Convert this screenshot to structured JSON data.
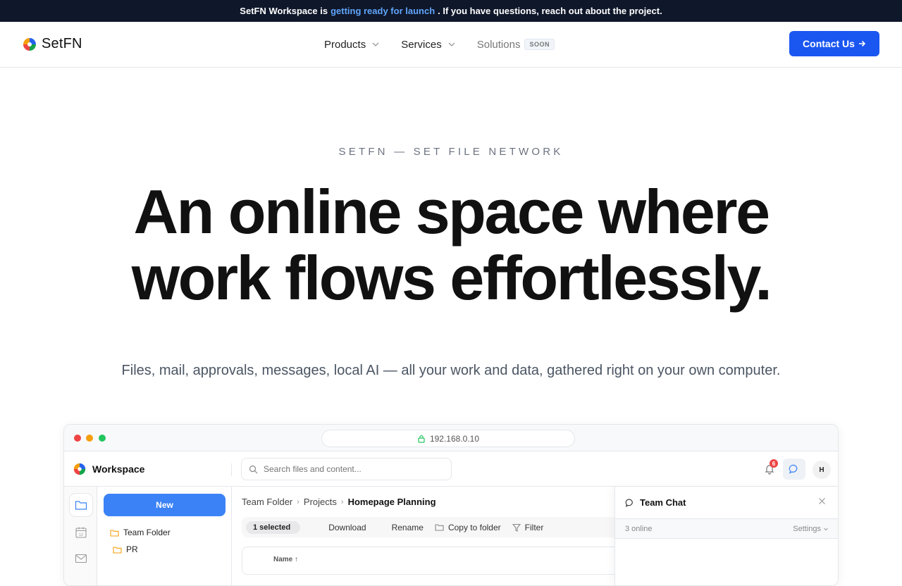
{
  "announcement": {
    "prefix": "SetFN Workspace is",
    "link": "getting ready for launch",
    "suffix": ". If you have questions, reach out about the project."
  },
  "nav": {
    "brand": "SetFN",
    "items": [
      {
        "label": "Products"
      },
      {
        "label": "Services"
      },
      {
        "label": "Solutions",
        "badge": "SOON"
      }
    ],
    "cta": "Contact Us"
  },
  "hero": {
    "eyebrow": "SETFN — SET FILE NETWORK",
    "headline_line1": "An online space where",
    "headline_line2": "work flows effortlessly.",
    "subline": "Files, mail, approvals, messages, local AI — all your work and data, gathered right on your own computer."
  },
  "mockup": {
    "address": "192.168.0.10",
    "app_name": "Workspace",
    "search_placeholder": "Search files and content...",
    "notification_count": "6",
    "avatar_initial": "H",
    "new_button": "New",
    "tree": [
      "Team Folder",
      "PR"
    ],
    "breadcrumb": {
      "root": "Team Folder",
      "mid": "Projects",
      "current": "Homepage Planning"
    },
    "toolbar": {
      "selected": "1 selected",
      "download": "Download",
      "rename": "Rename",
      "copy": "Copy to folder",
      "filter": "Filter"
    },
    "table": {
      "name_header": "Name ↑"
    },
    "chat": {
      "title": "Team Chat",
      "online": "3 online",
      "settings": "Settings"
    },
    "colors": {
      "brand_blue": "#1a56f0",
      "new_button": "#3b82f6",
      "topbar": "#0f172a",
      "link": "#60a5fa"
    }
  }
}
